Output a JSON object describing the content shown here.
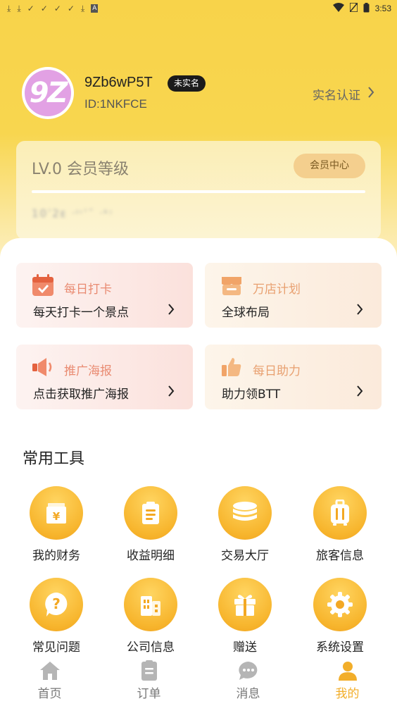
{
  "status_bar": {
    "time": "3:53",
    "left_icons": [
      "download-icon",
      "download-icon",
      "check-icon",
      "check-icon",
      "check-icon",
      "check-icon",
      "download-icon",
      "a-icon"
    ],
    "right_icons": [
      "wifi-icon",
      "sim-icon",
      "battery-icon"
    ]
  },
  "profile": {
    "avatar_text": "9Z",
    "username": "9Zb6wP5T",
    "badge": "未实名",
    "user_id": "ID:1NKFCE",
    "verify_label": "实名认证"
  },
  "member": {
    "level": "LV.0 会员等级",
    "center_button": "会员中心",
    "progress": 0,
    "obscured_text": "10ˈ2ᴇ ᐧᶦᶥˈˉ ᐧᵏᵎ"
  },
  "features": [
    {
      "title": "每日打卡",
      "subtitle": "每天打卡一个景点",
      "icon": "calendar-check-icon",
      "style": "pink"
    },
    {
      "title": "万店计划",
      "subtitle": "全球布局",
      "icon": "store-icon",
      "style": "cream"
    },
    {
      "title": "推广海报",
      "subtitle": "点击获取推广海报",
      "icon": "megaphone-icon",
      "style": "pink"
    },
    {
      "title": "每日助力",
      "subtitle": "助力领BTT",
      "icon": "thumbs-up-icon",
      "style": "cream"
    }
  ],
  "tools_section": {
    "title": "常用工具",
    "items": [
      {
        "label": "我的财务",
        "icon": "wallet-icon"
      },
      {
        "label": "收益明细",
        "icon": "clipboard-icon"
      },
      {
        "label": "交易大厅",
        "icon": "coins-icon"
      },
      {
        "label": "旅客信息",
        "icon": "luggage-icon"
      },
      {
        "label": "常见问题",
        "icon": "question-icon"
      },
      {
        "label": "公司信息",
        "icon": "building-icon"
      },
      {
        "label": "赠送",
        "icon": "gift-icon"
      },
      {
        "label": "系统设置",
        "icon": "gear-icon"
      }
    ]
  },
  "nav": {
    "items": [
      {
        "label": "首页",
        "icon": "home-icon",
        "active": false
      },
      {
        "label": "订单",
        "icon": "orders-icon",
        "active": false
      },
      {
        "label": "消息",
        "icon": "message-icon",
        "active": false
      },
      {
        "label": "我的",
        "icon": "user-icon",
        "active": true
      }
    ],
    "active_color": "#f2ae2a",
    "inactive_color": "#b5b5b5"
  },
  "colors": {
    "accent": "#f8d34a",
    "tool_icon": "#f7b52d",
    "pink_title": "#e98b72",
    "cream_title": "#e8a070"
  }
}
